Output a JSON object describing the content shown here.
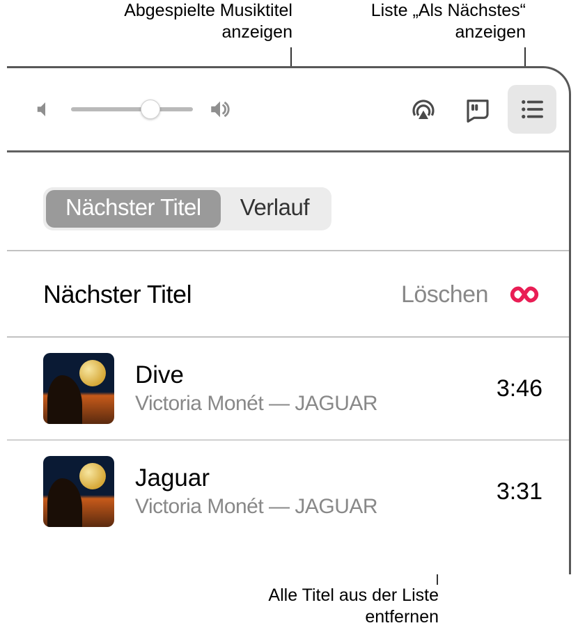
{
  "callouts": {
    "verlauf_hint": "Abgespielte Musiktitel anzeigen",
    "queue_hint": "Liste „Als Nächstes“ anzeigen",
    "clear_hint": "Alle Titel aus der Liste entfernen"
  },
  "toolbar": {
    "volume_icon_low": "volume-low-icon",
    "volume_icon_high": "volume-high-icon",
    "volume_value": 0.65,
    "airplay_icon": "airplay-icon",
    "lyrics_icon": "lyrics-icon",
    "queue_icon": "queue-list-icon"
  },
  "segmented": {
    "next_label": "Nächster Titel",
    "history_label": "Verlauf",
    "active": "next"
  },
  "section": {
    "heading": "Nächster Titel",
    "clear_label": "Löschen",
    "autoplay_icon": "infinity-icon"
  },
  "tracks": [
    {
      "title": "Dive",
      "artist_album": "Victoria Monét — JAGUAR",
      "duration": "3:46"
    },
    {
      "title": "Jaguar",
      "artist_album": "Victoria Monét — JAGUAR",
      "duration": "3:31"
    }
  ]
}
